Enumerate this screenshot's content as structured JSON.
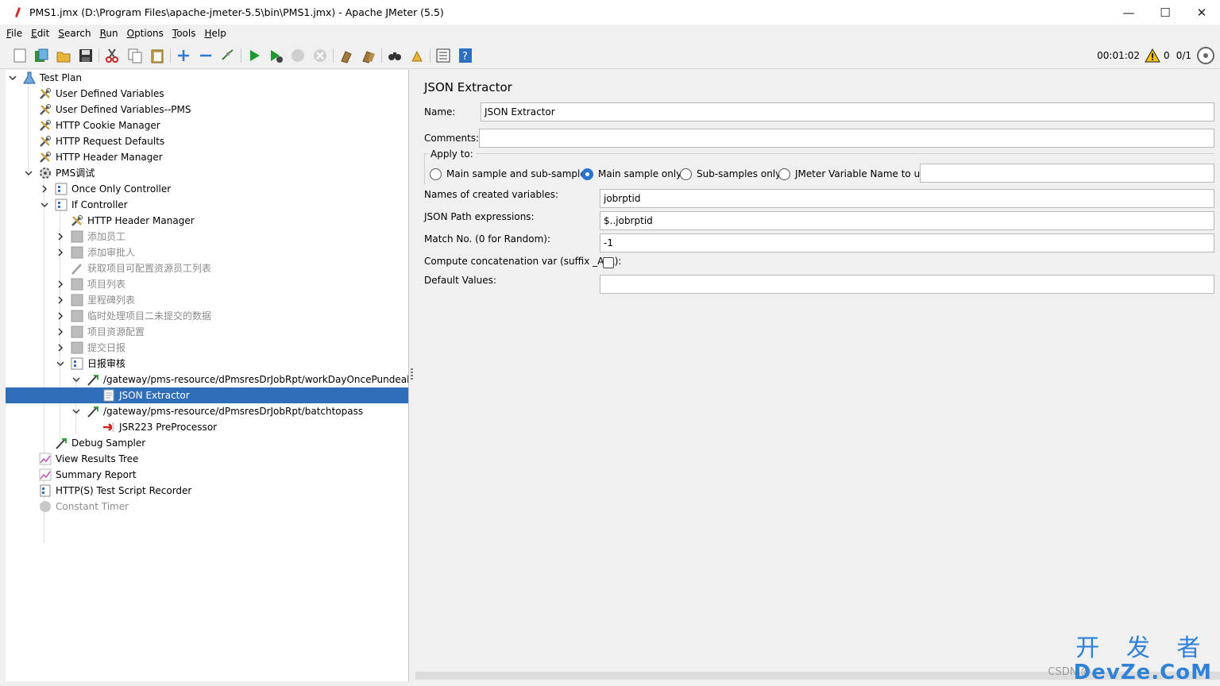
{
  "window": {
    "title": "PMS1.jmx (D:\\Program Files\\apache-jmeter-5.5\\bin\\PMS1.jmx) - Apache JMeter (5.5)",
    "minimize": "—",
    "maximize": "☐",
    "close": "✕"
  },
  "menu": [
    {
      "key": "F",
      "rest": "ile"
    },
    {
      "key": "E",
      "rest": "dit"
    },
    {
      "key": "S",
      "rest": "earch"
    },
    {
      "key": "R",
      "rest": "un"
    },
    {
      "key": "O",
      "rest": "ptions"
    },
    {
      "key": "T",
      "rest": "ools"
    },
    {
      "key": "H",
      "rest": "elp"
    }
  ],
  "toolbar": {
    "elapsed": "00:01:02",
    "warnings": "0",
    "threads": "0/1"
  },
  "tree": [
    {
      "label": "Test Plan",
      "icon": "test-plan-icon"
    },
    {
      "label": "User Defined Variables",
      "icon": "config-icon"
    },
    {
      "label": "User Defined Variables--PMS",
      "icon": "config-icon"
    },
    {
      "label": "HTTP Cookie Manager",
      "icon": "config-icon"
    },
    {
      "label": "HTTP Request Defaults",
      "icon": "config-icon"
    },
    {
      "label": "HTTP Header Manager",
      "icon": "config-icon"
    },
    {
      "label": "PMS调试",
      "icon": "thread-group-icon"
    },
    {
      "label": "Once Only Controller",
      "icon": "controller-icon"
    },
    {
      "label": "If Controller",
      "icon": "controller-icon"
    },
    {
      "label": "HTTP Header Manager",
      "icon": "config-icon"
    },
    {
      "label": "添加员工",
      "icon": "controller-icon"
    },
    {
      "label": "添加审批人",
      "icon": "controller-icon"
    },
    {
      "label": "获取项目可配置资源员工列表",
      "icon": "sampler-icon"
    },
    {
      "label": "项目列表",
      "icon": "controller-icon"
    },
    {
      "label": "里程碑列表",
      "icon": "controller-icon"
    },
    {
      "label": "临时处理项目二未提交的数据",
      "icon": "controller-icon"
    },
    {
      "label": "项目资源配置",
      "icon": "controller-icon"
    },
    {
      "label": "提交日报",
      "icon": "controller-icon"
    },
    {
      "label": "日报审核",
      "icon": "controller-icon"
    },
    {
      "label": "/gateway/pms-resource/dPmsresDrJobRpt/workDayOncePundealList",
      "icon": "sampler-icon"
    },
    {
      "label": "JSON Extractor",
      "icon": "extractor-icon"
    },
    {
      "label": "/gateway/pms-resource/dPmsresDrJobRpt/batchtopass",
      "icon": "sampler-icon"
    },
    {
      "label": "JSR223 PreProcessor",
      "icon": "preprocessor-icon"
    },
    {
      "label": "Debug Sampler",
      "icon": "sampler-icon"
    },
    {
      "label": "View Results Tree",
      "icon": "listener-icon"
    },
    {
      "label": "Summary Report",
      "icon": "listener-icon"
    },
    {
      "label": "HTTP(S) Test Script Recorder",
      "icon": "recorder-icon"
    },
    {
      "label": "Constant Timer",
      "icon": "timer-icon"
    }
  ],
  "editor": {
    "title": "JSON Extractor",
    "name_label": "Name:",
    "name_value": "JSON Extractor",
    "comments_label": "Comments:",
    "comments_value": "",
    "apply_to_label": "Apply to:",
    "apply_options": [
      {
        "label": "Main sample and sub-samples",
        "selected": false
      },
      {
        "label": "Main sample only",
        "selected": true
      },
      {
        "label": "Sub-samples only",
        "selected": false
      },
      {
        "label": "JMeter Variable Name to use",
        "selected": false
      }
    ],
    "jmeter_var_value": "",
    "var_names_label": "Names of created variables:",
    "var_names_value": "jobrptid",
    "json_path_label": "JSON Path expressions:",
    "json_path_value": "$..jobrptid",
    "match_no_label": "Match No. (0 for Random):",
    "match_no_value": "-1",
    "concat_label": "Compute concatenation var (suffix _ALL):",
    "concat_checked": false,
    "default_label": "Default Values:",
    "default_value": ""
  },
  "watermark": {
    "chinese": "开 发 者",
    "english": "DevZe.CoM",
    "csdn": "CSDN @..."
  }
}
